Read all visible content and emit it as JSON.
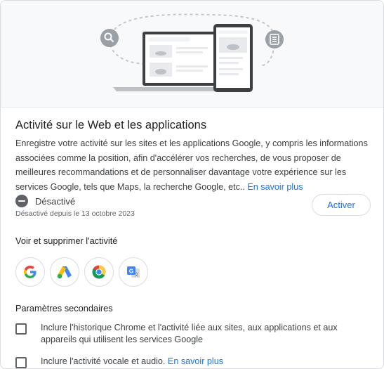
{
  "section": {
    "title": "Activité sur le Web et les applications",
    "description": "Enregistre votre activité sur les sites et les applications Google, y compris les informations associées comme la position, afin d'accélérer vos recherches, de vous proposer de meilleures recommandations et de personnaliser davantage votre expérience sur les services Google, tels que Maps, la recherche Google, etc..",
    "learn_more": "En savoir plus"
  },
  "status": {
    "label": "Désactivé",
    "since": "Désactivé depuis le 13 octobre 2023",
    "action_label": "Activer"
  },
  "activity": {
    "title": "Voir et supprimer l'activité",
    "apps": [
      {
        "icon": "google-icon"
      },
      {
        "icon": "google-ads-icon"
      },
      {
        "icon": "chrome-icon"
      },
      {
        "icon": "google-translate-icon"
      }
    ]
  },
  "secondary": {
    "title": "Paramètres secondaires",
    "options": [
      {
        "label": "Inclure l'historique Chrome et l'activité liée aux sites, aux applications et aux appareils qui utilisent les services Google",
        "checked": false
      },
      {
        "label": "Inclure l'activité vocale et audio.",
        "link": "En savoir plus",
        "checked": false
      }
    ]
  },
  "colors": {
    "accent": "#1a73e8",
    "hero_bg": "#f8f9fa",
    "status_icon": "#5f6368"
  }
}
